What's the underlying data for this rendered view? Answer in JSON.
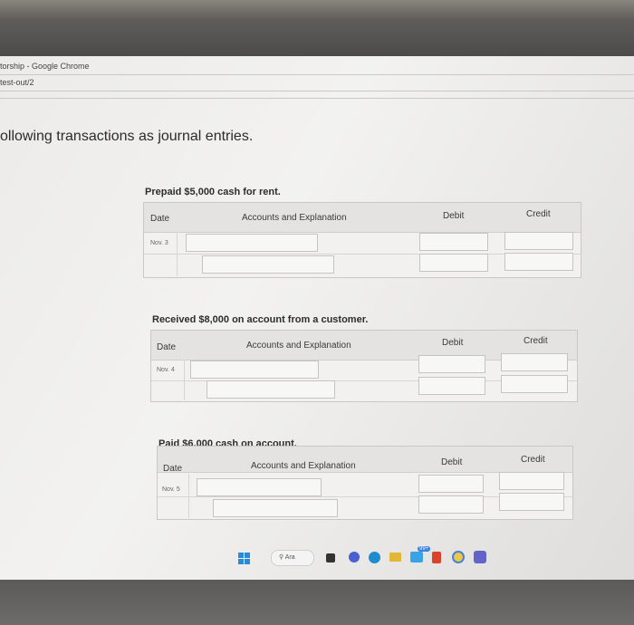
{
  "browser": {
    "title": "torship - Google Chrome",
    "url": "test-out/2"
  },
  "page": {
    "heading": "ollowing transactions as journal entries."
  },
  "table_headers": {
    "date": "Date",
    "accounts": "Accounts and Explanation",
    "debit": "Debit",
    "credit": "Credit"
  },
  "entries": [
    {
      "prompt": "Prepaid $5,000 cash for rent.",
      "date": "Nov. 3"
    },
    {
      "prompt": "Received $8,000 on account from a customer.",
      "date": "Nov. 4"
    },
    {
      "prompt": "Paid $6,000 cash on account.",
      "date": "Nov. 5"
    }
  ],
  "taskbar": {
    "search_placeholder": "Ara",
    "notification_badge": "99+",
    "icons": [
      "windows-start-icon",
      "search-icon",
      "task-view-icon",
      "chat-icon",
      "edge-icon",
      "file-explorer-icon",
      "store-icon",
      "mail-icon",
      "office-icon",
      "teams-icon"
    ]
  }
}
